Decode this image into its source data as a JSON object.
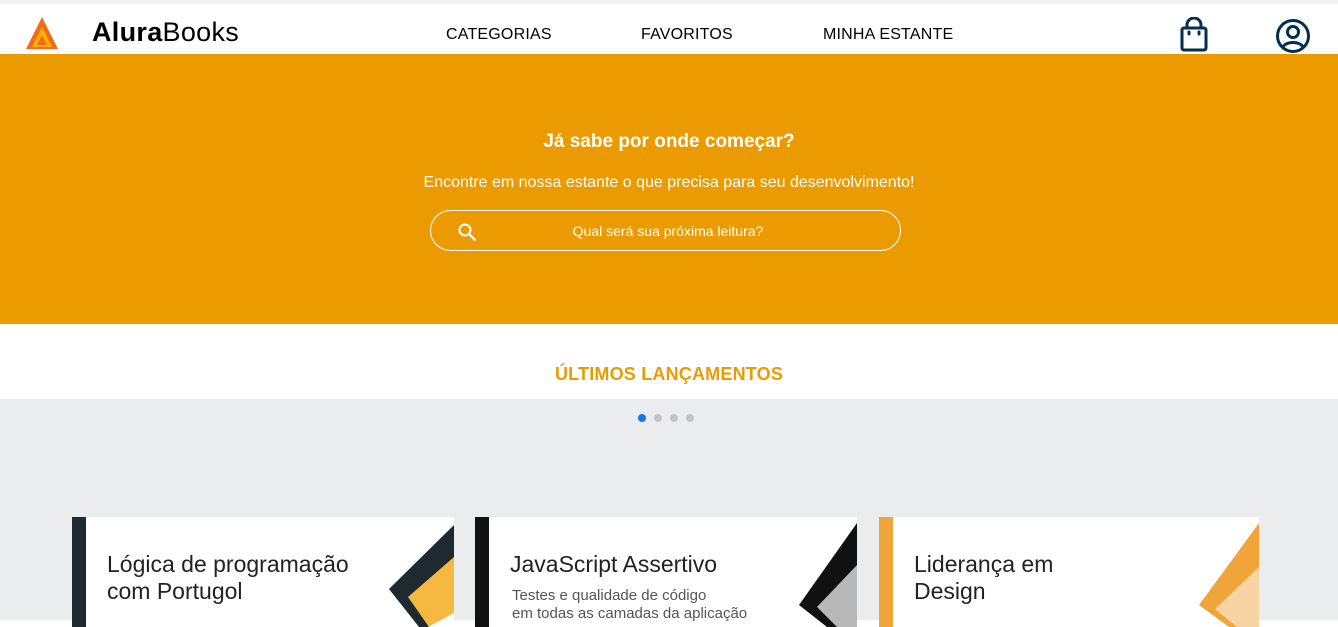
{
  "header": {
    "brand_bold": "Alura",
    "brand_rest": "Books",
    "nav": [
      "CATEGORIAS",
      "FAVORITOS",
      "MINHA ESTANTE"
    ],
    "icons": [
      "logo-icon",
      "shopping-bag-icon",
      "user-account-icon"
    ]
  },
  "hero": {
    "title": "Já sabe por onde começar?",
    "subtitle": "Encontre em nossa estante o que precisa para seu desenvolvimento!",
    "search_placeholder": "Qual será sua próxima leitura?"
  },
  "releases": {
    "title": "ÚLTIMOS LANÇAMENTOS",
    "carousel_dots": 4,
    "active_dot": 0,
    "books": [
      {
        "title_line1": "Lógica de programação",
        "title_line2": "com Portugol",
        "subtitle_line1": "",
        "subtitle_line2": ""
      },
      {
        "title_line1": "JavaScript Assertivo",
        "title_line2": "",
        "subtitle_line1": "Testes e qualidade de código",
        "subtitle_line2": "em todas as camadas da aplicação"
      },
      {
        "title_line1": "Liderança em",
        "title_line2": "Design",
        "subtitle_line1": "",
        "subtitle_line2": ""
      }
    ]
  },
  "colors": {
    "brand_orange": "#eb9b00",
    "carousel_bg": "#ebecee",
    "dot_active": "#1875e8",
    "dot_inactive": "#c0c3c8",
    "book1_accent": "#1f2a30",
    "book2_accent": "#111111",
    "book3_accent": "#f0a53a"
  }
}
